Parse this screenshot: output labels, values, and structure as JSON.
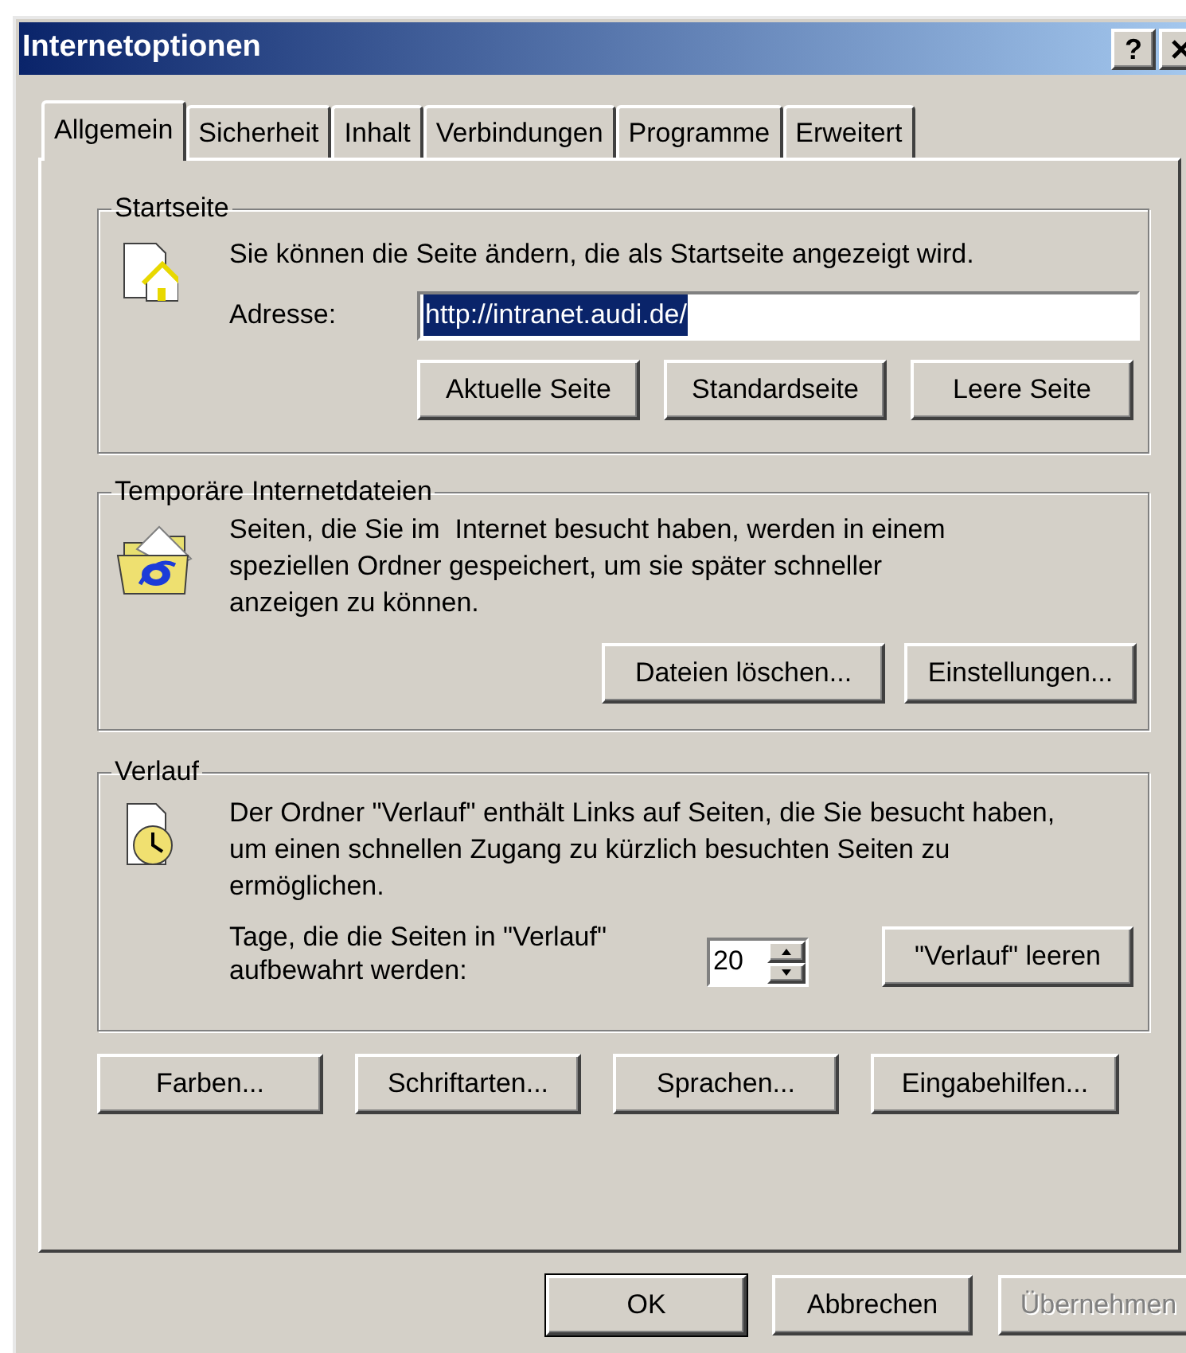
{
  "window": {
    "title": "Internetoptionen",
    "help_button": "?"
  },
  "tabs": [
    {
      "label": "Allgemein",
      "selected": true
    },
    {
      "label": "Sicherheit",
      "selected": false
    },
    {
      "label": "Inhalt",
      "selected": false
    },
    {
      "label": "Verbindungen",
      "selected": false
    },
    {
      "label": "Programme",
      "selected": false
    },
    {
      "label": "Erweitert",
      "selected": false
    }
  ],
  "start_page": {
    "title": "Startseite",
    "text": "Sie können die Seite ändern, die als Startseite angezeigt wird.",
    "address_label": "Adresse:",
    "address_value": "http://intranet.audi.de/",
    "address_selected": true,
    "buttons": [
      "Aktuelle Seite",
      "Standardseite",
      "Leere Seite"
    ]
  },
  "temp_files": {
    "title": "Temporäre Internetdateien",
    "text": "Seiten, die Sie im  Internet besucht haben, werden in einem speziellen Ordner gespeichert, um sie später schneller anzeigen zu können.",
    "buttons": [
      "Dateien löschen...",
      "Einstellungen..."
    ]
  },
  "history": {
    "title": "Verlauf",
    "text": "Der Ordner \"Verlauf\" enthält Links auf Seiten, die Sie besucht haben, um einen schnellen Zugang zu kürzlich besuchten Seiten zu ermöglichen.",
    "days_label": "Tage, die die Seiten in \"Verlauf\" aufbewahrt werden:",
    "days_value": "20",
    "clear_button": "\"Verlauf\" leeren"
  },
  "option_buttons": [
    "Farben...",
    "Schriftarten...",
    "Sprachen...",
    "Eingabehilfen..."
  ],
  "dialog_buttons": [
    {
      "label": "OK",
      "default": true,
      "disabled": false
    },
    {
      "label": "Abbrechen",
      "default": false,
      "disabled": false
    },
    {
      "label": "Übernehmen",
      "default": false,
      "disabled": true
    }
  ]
}
